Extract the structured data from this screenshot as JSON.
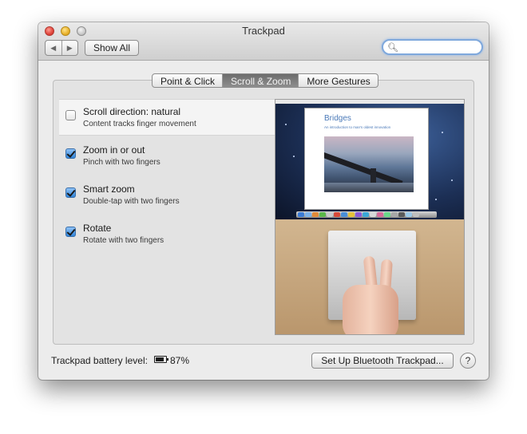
{
  "window": {
    "title": "Trackpad"
  },
  "toolbar": {
    "back_glyph": "◀",
    "forward_glyph": "▶",
    "show_all_label": "Show All",
    "search_placeholder": "",
    "search_icon": "magnifier-icon"
  },
  "tabs": [
    {
      "label": "Point & Click",
      "active": false
    },
    {
      "label": "Scroll & Zoom",
      "active": true
    },
    {
      "label": "More Gestures",
      "active": false
    }
  ],
  "options": [
    {
      "title": "Scroll direction: natural",
      "subtitle": "Content tracks finger movement",
      "checked": false,
      "selected": true
    },
    {
      "title": "Zoom in or out",
      "subtitle": "Pinch with two fingers",
      "checked": true,
      "selected": false
    },
    {
      "title": "Smart zoom",
      "subtitle": "Double-tap with two fingers",
      "checked": true,
      "selected": false
    },
    {
      "title": "Rotate",
      "subtitle": "Rotate with two fingers",
      "checked": true,
      "selected": false
    }
  ],
  "preview": {
    "doc_title": "Bridges",
    "doc_subtitle": "An introduction to man's oldest innovation"
  },
  "footer": {
    "battery_label": "Trackpad battery level:",
    "battery_level": 0.87,
    "battery_percent": "87%",
    "setup_button": "Set Up Bluetooth Trackpad...",
    "help_label": "?"
  },
  "colors": {
    "checkbox_checked": "#2f83d9",
    "search_focus": "#7fa8dc"
  }
}
